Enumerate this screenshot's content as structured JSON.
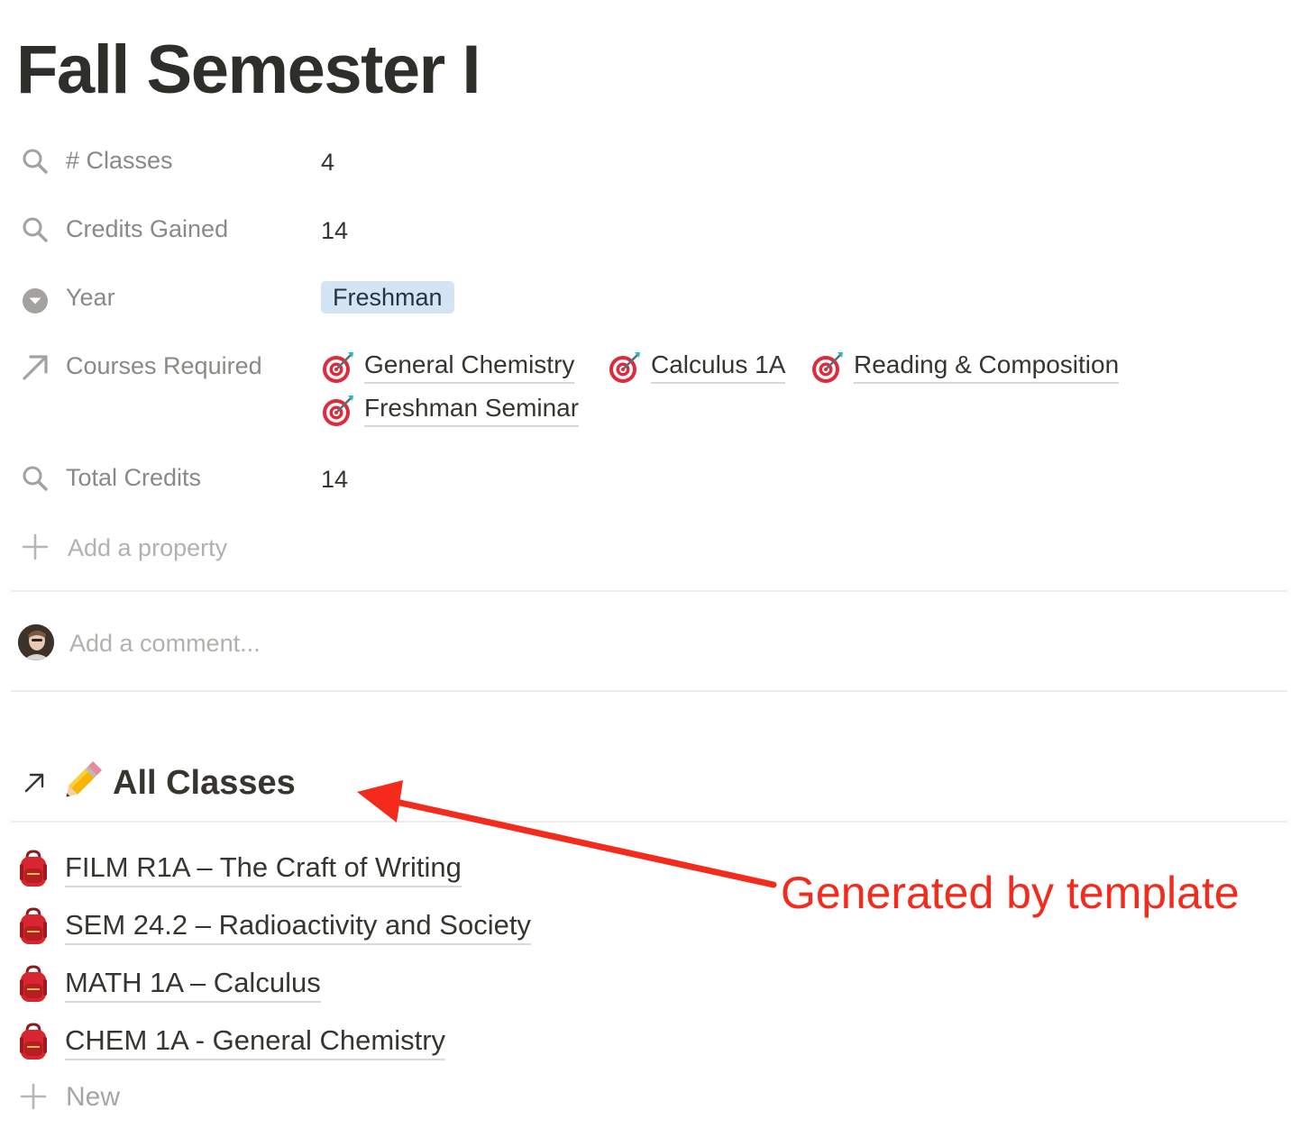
{
  "page": {
    "title": "Fall Semester I"
  },
  "properties": {
    "classes": {
      "label": "# Classes",
      "value": "4",
      "icon": "search-icon"
    },
    "credits_gained": {
      "label": "Credits Gained",
      "value": "14",
      "icon": "search-icon"
    },
    "year": {
      "label": "Year",
      "value": "Freshman",
      "icon": "select-chevron-icon",
      "tag_color": "#d3e5f4"
    },
    "courses_required": {
      "label": "Courses Required",
      "icon": "relation-arrow-icon",
      "items": [
        {
          "label": "General Chemistry",
          "icon": "target-icon"
        },
        {
          "label": "Calculus 1A",
          "icon": "target-icon"
        },
        {
          "label": "Reading & Composition",
          "icon": "target-icon"
        },
        {
          "label": "Freshman Seminar",
          "icon": "target-icon"
        }
      ]
    },
    "total_credits": {
      "label": "Total Credits",
      "value": "14",
      "icon": "search-icon"
    },
    "add_property": {
      "label": "Add a property",
      "icon": "plus-icon"
    }
  },
  "comments": {
    "placeholder": "Add a comment..."
  },
  "linked_database": {
    "title": "All Classes",
    "icon": "pencil-icon",
    "link_icon": "arrow-up-right-icon",
    "items": [
      {
        "label": "FILM R1A – The Craft of Writing",
        "icon": "backpack-icon"
      },
      {
        "label": "SEM 24.2 – Radioactivity and Society",
        "icon": "backpack-icon"
      },
      {
        "label": "MATH 1A – Calculus",
        "icon": "backpack-icon"
      },
      {
        "label": "CHEM 1A - General Chemistry",
        "icon": "backpack-icon"
      }
    ],
    "new_label": "New"
  },
  "annotation": {
    "text": "Generated by template",
    "color": "#f42a1c"
  }
}
